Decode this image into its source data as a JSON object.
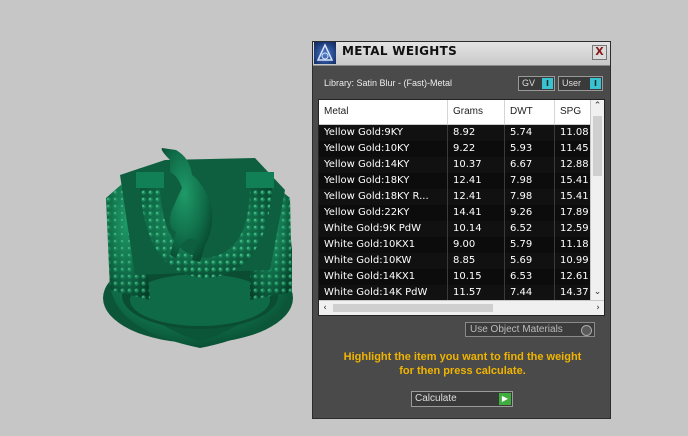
{
  "window": {
    "title": "METAL WEIGHTS",
    "close_glyph": "X"
  },
  "library_label": "Library: Satin Blur - (Fast)-Metal",
  "toggles": [
    {
      "label": "GV",
      "icon": "toggle-icon"
    },
    {
      "label": "User",
      "icon": "toggle-icon"
    }
  ],
  "table": {
    "headers": [
      "Metal",
      "Grams",
      "DWT",
      "SPG"
    ],
    "rows": [
      [
        "Yellow Gold:9KY",
        "8.92",
        "5.74",
        "11.08"
      ],
      [
        "Yellow Gold:10KY",
        "9.22",
        "5.93",
        "11.45"
      ],
      [
        "Yellow Gold:14KY",
        "10.37",
        "6.67",
        "12.88"
      ],
      [
        "Yellow Gold:18KY",
        "12.41",
        "7.98",
        "15.41"
      ],
      [
        "Yellow Gold:18KY R...",
        "12.41",
        "7.98",
        "15.41"
      ],
      [
        "Yellow Gold:22KY",
        "14.41",
        "9.26",
        "17.89"
      ],
      [
        "White Gold:9K PdW",
        "10.14",
        "6.52",
        "12.59"
      ],
      [
        "White Gold:10KX1",
        "9.00",
        "5.79",
        "11.18"
      ],
      [
        "White Gold:10KW",
        "8.85",
        "5.69",
        "10.99"
      ],
      [
        "White Gold:14KX1",
        "10.15",
        "6.53",
        "12.61"
      ],
      [
        "White Gold:14K PdW",
        "11.57",
        "7.44",
        "14.37"
      ]
    ]
  },
  "use_object_materials": "Use Object Materials",
  "instruction_line1": "Highlight the item you want to find the weight",
  "instruction_line2": "for then press calculate.",
  "calculate_label": "Calculate",
  "colors": {
    "background": "#c6c6c6",
    "panel": "#4a4a4a",
    "ring": "#0f6b47",
    "accent_text": "#f0b400",
    "toggle": "#39c3cf"
  }
}
